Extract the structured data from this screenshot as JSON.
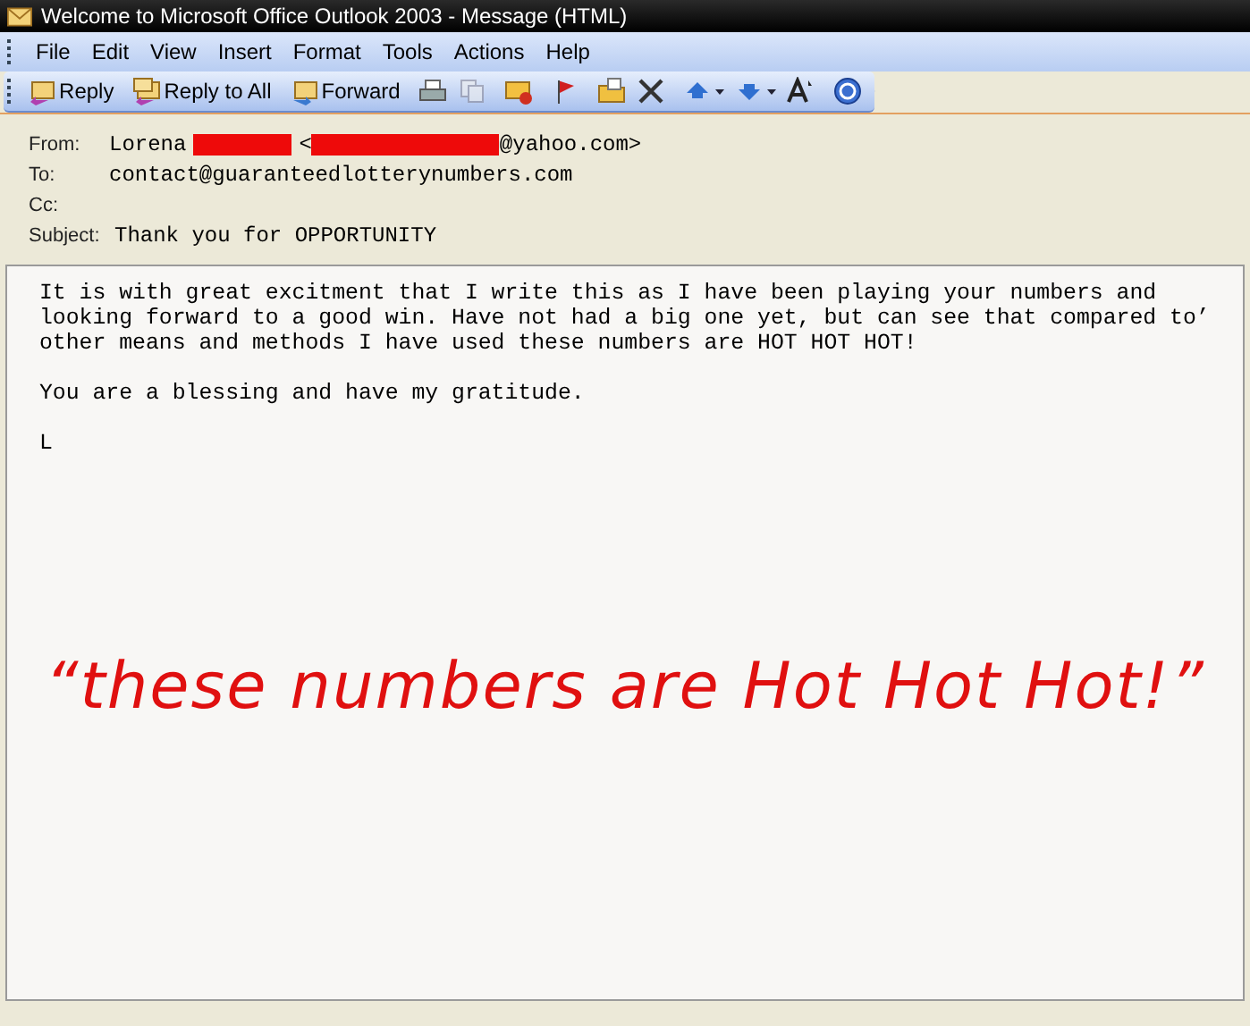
{
  "window": {
    "title": "Welcome to Microsoft Office Outlook 2003 - Message (HTML)"
  },
  "menu": [
    "File",
    "Edit",
    "View",
    "Insert",
    "Format",
    "Tools",
    "Actions",
    "Help"
  ],
  "toolbar": [
    {
      "kind": "labeled",
      "label": "Reply"
    },
    {
      "kind": "separator"
    },
    {
      "kind": "labeled",
      "label": "Reply to All"
    },
    {
      "kind": "separator"
    },
    {
      "kind": "labeled",
      "label": "Forward"
    },
    {
      "kind": "separator"
    },
    {
      "kind": "icon"
    },
    {
      "kind": "icon"
    },
    {
      "kind": "separator"
    },
    {
      "kind": "icon"
    },
    {
      "kind": "separator"
    },
    {
      "kind": "icon"
    },
    {
      "kind": "separator"
    },
    {
      "kind": "icon"
    },
    {
      "kind": "icon"
    },
    {
      "kind": "separator"
    },
    {
      "kind": "dropdown"
    },
    {
      "kind": "dropdown"
    },
    {
      "kind": "icon"
    },
    {
      "kind": "separator"
    },
    {
      "kind": "icon"
    }
  ],
  "header": {
    "from_label": "From:",
    "from_name": "Lorena",
    "from_bracket": "<",
    "from_tail": "@yahoo.com>",
    "to_label": "To:",
    "to": "contact@guaranteedlotterynumbers.com",
    "cc_label": "Cc:",
    "subject_label": "Subject:",
    "subject": "Thank you for OPPORTUNITY"
  },
  "body": [
    "It is with great excitment that I write this as I have been playing your numbers and\nlooking forward to a good win. Have not had a big one yet, but can see that compared to’\nother means and methods I have used these numbers are HOT HOT HOT!",
    "You are a blessing and have my gratitude.",
    "L"
  ],
  "annotation": "“these numbers are Hot Hot Hot!”"
}
